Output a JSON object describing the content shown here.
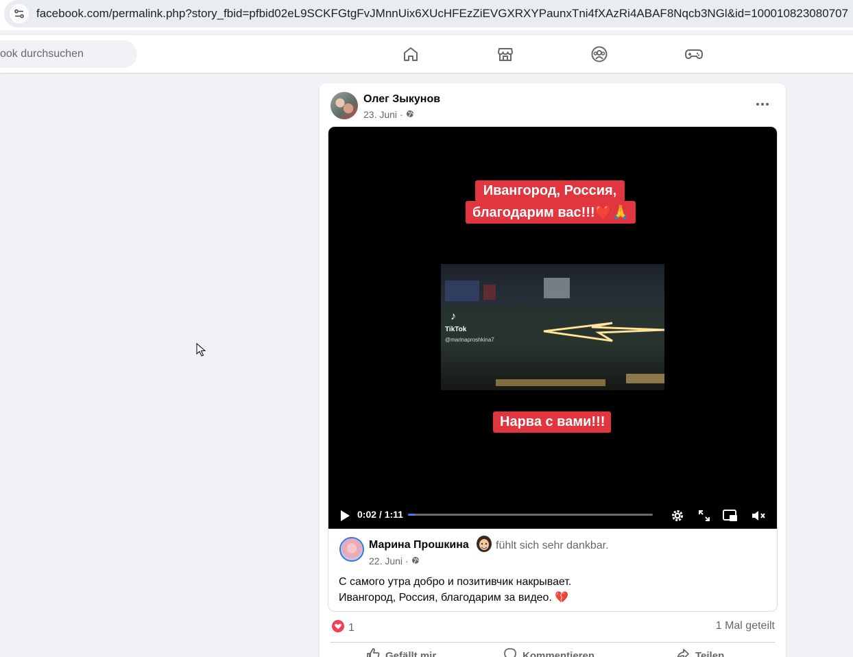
{
  "browser": {
    "url": "facebook.com/permalink.php?story_fbid=pfbid02eL9SCKFGtgFvJMnnUix6XUcHFEzZiEVGXRXYPaunxTni4fXAzRi4ABAF8Nqcb3NGl&id=100010823080707"
  },
  "nav": {
    "search_placeholder": "ook durchsuchen",
    "icons": [
      "home-icon",
      "marketplace-icon",
      "groups-icon",
      "gaming-icon"
    ]
  },
  "post": {
    "author": "Олег Зыкунов",
    "date": "23. Juni",
    "separator": "·",
    "video": {
      "caption_line1": "Ивангород, Россия,",
      "caption_line2": "благодарим вас!!!❤️🙏",
      "caption_bottom": "Нарва с вами!!!",
      "tiktok_label": "TikTok",
      "tiktok_handle": "@marinaproshkina7",
      "time": "0:02 / 1:11",
      "progress": 0.03
    },
    "shared": {
      "author": "Марина Прошкина",
      "feeling": "fühlt sich sehr dankbar.",
      "date": "22. Juni",
      "text_line1": "С самого утра добро и позитивчик накрывает.",
      "text_line2": "Ивангород, Россия, благодарим за видео. 💔"
    },
    "reactions_count": "1",
    "shares": "1 Mal geteilt",
    "actions": {
      "like": "Gefällt mir",
      "comment": "Kommentieren",
      "share": "Teilen"
    }
  },
  "colors": {
    "fb_blue": "#0866ff",
    "caption_red": "#e1363f",
    "progress_blue": "#4a7cf7",
    "page_bg": "#f0f2f5"
  }
}
